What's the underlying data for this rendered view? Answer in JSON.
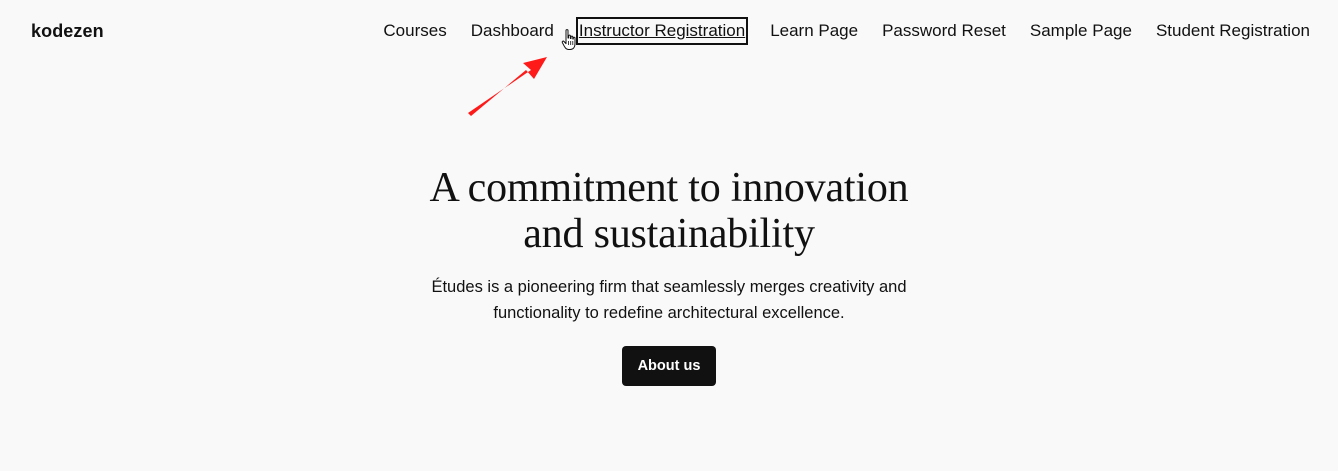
{
  "site": {
    "title": "kodezen"
  },
  "nav": {
    "items": [
      {
        "label": "Courses"
      },
      {
        "label": "Dashboard"
      },
      {
        "label": "Instructor Registration",
        "state": "focused"
      },
      {
        "label": "Learn Page"
      },
      {
        "label": "Password Reset"
      },
      {
        "label": "Sample Page"
      },
      {
        "label": "Student Registration"
      }
    ]
  },
  "hero": {
    "heading_line1": "A commitment to innovation",
    "heading_line2": "and sustainability",
    "text_line1": "Études is a pioneering firm that seamlessly merges creativity and",
    "text_line2": "functionality to redefine architectural excellence.",
    "button_label": "About us"
  },
  "annotation": {
    "arrow_color": "#ff1a1a",
    "cursor_icon": "hand-pointer-icon"
  },
  "colors": {
    "background": "#f9f9f9",
    "text": "#111111",
    "button_bg": "#111111",
    "button_text": "#ffffff"
  }
}
